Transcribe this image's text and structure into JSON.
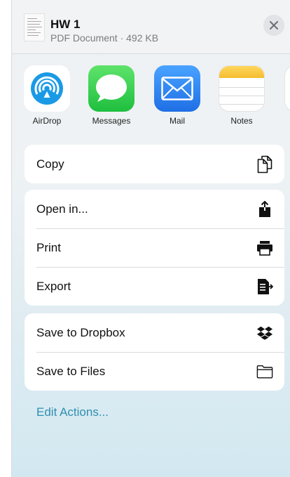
{
  "header": {
    "title": "HW 1",
    "subtitle": "PDF Document · 492 KB"
  },
  "apps": [
    {
      "label": "AirDrop",
      "icon": "airdrop-icon"
    },
    {
      "label": "Messages",
      "icon": "messages-icon"
    },
    {
      "label": "Mail",
      "icon": "mail-icon"
    },
    {
      "label": "Notes",
      "icon": "notes-icon"
    }
  ],
  "groups": {
    "copy": {
      "label": "Copy",
      "icon": "copy-icon"
    },
    "open_in": {
      "label": "Open in...",
      "icon": "share-icon"
    },
    "print": {
      "label": "Print",
      "icon": "printer-icon"
    },
    "export": {
      "label": "Export",
      "icon": "export-icon"
    },
    "dropbox": {
      "label": "Save to Dropbox",
      "icon": "dropbox-icon"
    },
    "files": {
      "label": "Save to Files",
      "icon": "folder-icon"
    }
  },
  "edit_actions": "Edit Actions...",
  "colors": {
    "accent": "#2f8fb0",
    "messages_green": "#35c759",
    "mail_blue": "#2f80ed",
    "notes_yellow": "#f7c744"
  }
}
